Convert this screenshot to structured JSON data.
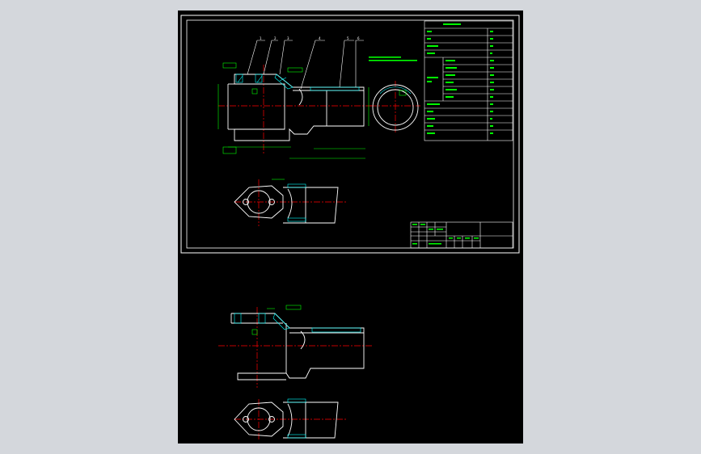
{
  "drawing": {
    "background_color": "#d4d7dc",
    "canvas_color": "#000000",
    "line_color": "#ffffff",
    "annotation_color": "#00ff00",
    "centerline_color": "#ff0000",
    "hatch_color": "#00ffff"
  },
  "balloons": [
    "1",
    "2",
    "3",
    "4",
    "5",
    "6"
  ]
}
